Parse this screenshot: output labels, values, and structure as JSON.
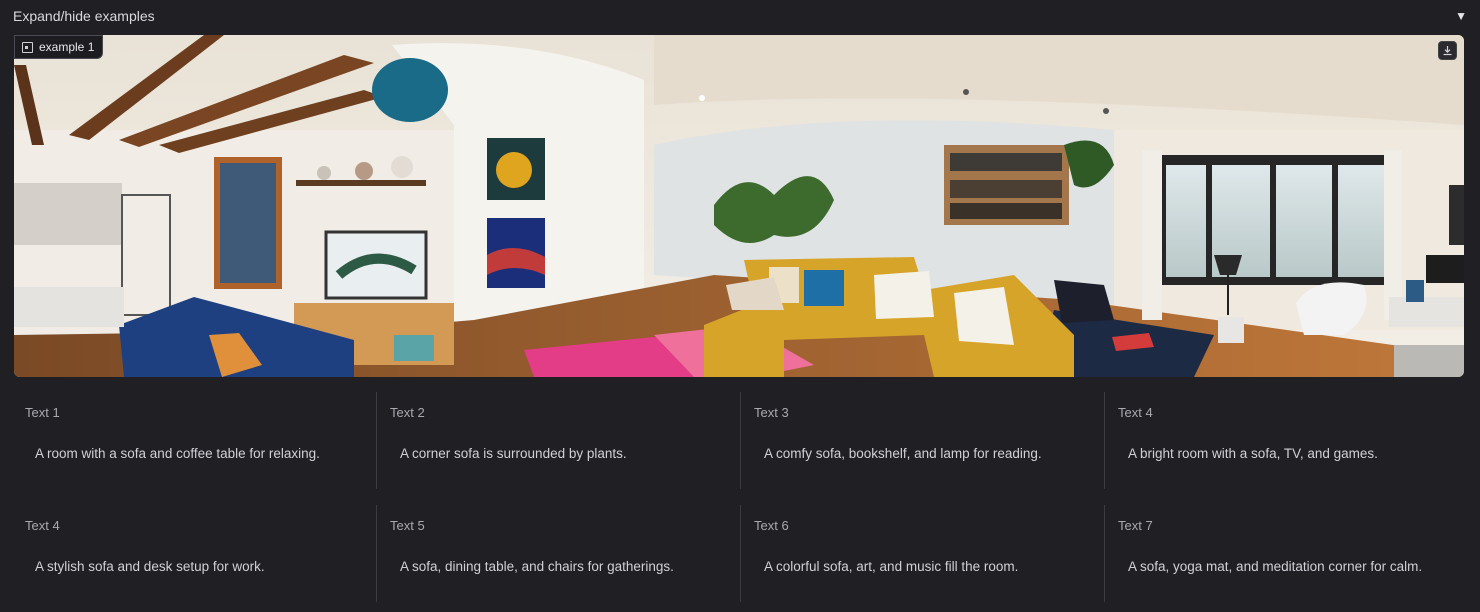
{
  "header": {
    "title": "Expand/hide examples",
    "toggle_icon": "▼"
  },
  "image": {
    "label": "example 1",
    "label_icon": "image-icon",
    "download_icon": "download-icon"
  },
  "examples": [
    {
      "label": "Text 1",
      "value": "A room with a sofa and coffee table for relaxing."
    },
    {
      "label": "Text 2",
      "value": "A corner sofa is surrounded by plants."
    },
    {
      "label": "Text 3",
      "value": "A comfy sofa, bookshelf, and lamp for reading."
    },
    {
      "label": "Text 4",
      "value": "A bright room with a sofa, TV, and games."
    },
    {
      "label": "Text 4",
      "value": "A stylish sofa and desk setup for work."
    },
    {
      "label": "Text 5",
      "value": "A sofa, dining table, and chairs for gatherings."
    },
    {
      "label": "Text 6",
      "value": "A colorful sofa, art, and music fill the room."
    },
    {
      "label": "Text 7",
      "value": "A sofa, yoga mat, and meditation corner for calm."
    }
  ]
}
